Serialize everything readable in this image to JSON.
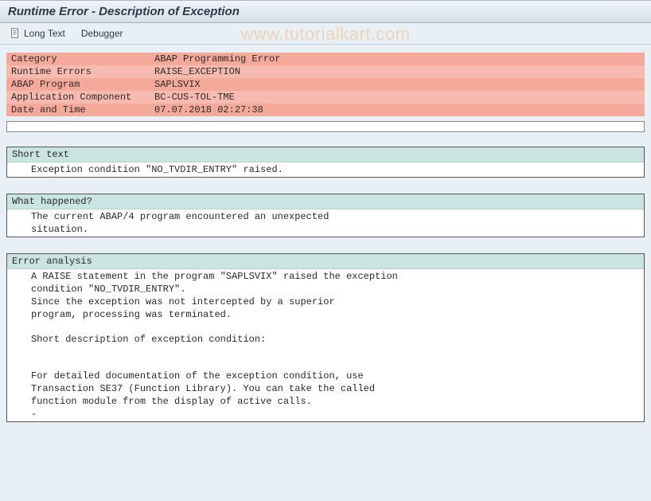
{
  "title": "Runtime Error - Description of Exception",
  "toolbar": {
    "long_text_label": "Long Text",
    "debugger_label": "Debugger"
  },
  "info": {
    "rows": [
      {
        "label": "Category",
        "value": "ABAP Programming Error"
      },
      {
        "label": "Runtime Errors",
        "value": "RAISE_EXCEPTION"
      },
      {
        "label": "ABAP Program",
        "value": "SAPLSVIX"
      },
      {
        "label": "Application Component",
        "value": "BC-CUS-TOL-TME"
      },
      {
        "label": "Date and Time",
        "value": "07.07.2018 02:27:38"
      }
    ]
  },
  "sections": {
    "short_text": {
      "header": "Short text",
      "lines": [
        "Exception condition \"NO_TVDIR_ENTRY\" raised."
      ]
    },
    "what_happened": {
      "header": "What happened?",
      "lines": [
        "The current ABAP/4 program encountered an unexpected",
        "situation."
      ]
    },
    "error_analysis": {
      "header": "Error analysis",
      "lines": [
        "A RAISE statement in the program \"SAPLSVIX\" raised the exception",
        "condition \"NO_TVDIR_ENTRY\".",
        "Since the exception was not intercepted by a superior",
        "program, processing was terminated.",
        "",
        "Short description of exception condition:",
        "",
        "",
        "For detailed documentation of the exception condition, use",
        "Transaction SE37 (Function Library). You can take the called",
        "function module from the display of active calls.",
        "-"
      ]
    }
  },
  "watermark": "www.tutorialkart.com"
}
